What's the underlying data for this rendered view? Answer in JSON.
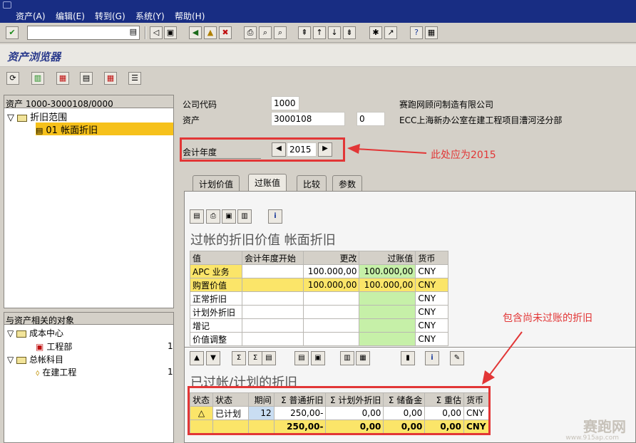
{
  "menu": [
    "资产(A)",
    "编辑(E)",
    "转到(G)",
    "系统(Y)",
    "帮助(H)"
  ],
  "title": "资产浏览器",
  "tree": {
    "header": "资产 1000-3000108/0000",
    "node": "折旧范围",
    "leaf": "01 帐面折旧"
  },
  "tree2": {
    "header": "与资产相关的对象",
    "cc": "成本中心",
    "cc_item": "工程部",
    "cc_count": "1",
    "gl": "总帐科目",
    "gl_item": "在建工程",
    "gl_count": "1"
  },
  "company": {
    "label": "公司代码",
    "value": "1000",
    "name": "赛跑网顾问制造有限公司"
  },
  "asset": {
    "label": "资产",
    "value": "3000108",
    "sub": "0",
    "name": "ECC上海新办公室在建工程项目漕河泾分部"
  },
  "fiscal": {
    "label": "会计年度",
    "value": "2015"
  },
  "annotation1": "此处应为2015",
  "annotation2": "包含尚未过账的折旧",
  "tabs": [
    "计划价值",
    "过账值",
    "比较",
    "参数"
  ],
  "section1_title": "过帐的折旧价值 帐面折旧",
  "table1": {
    "headers": [
      "值",
      "会计年度开始",
      "更改",
      "过账值",
      "货币"
    ],
    "rows": [
      [
        "APC 业务",
        "",
        "100.000,00",
        "100.000,00",
        "CNY"
      ],
      [
        "购置价值",
        "",
        "100.000,00",
        "100.000,00",
        "CNY"
      ],
      [
        "正常折旧",
        "",
        "",
        "",
        "CNY"
      ],
      [
        "计划外折旧",
        "",
        "",
        "",
        "CNY"
      ],
      [
        "增记",
        "",
        "",
        "",
        "CNY"
      ],
      [
        "价值调整",
        "",
        "",
        "",
        "CNY"
      ]
    ]
  },
  "section2_title": "已过帐/计划的折旧",
  "table2": {
    "headers": [
      "状态",
      "状态",
      "期间",
      "Σ 普通折旧",
      "Σ 计划外折旧",
      "Σ 储备金",
      "Σ 重估",
      "货币"
    ],
    "row": [
      "△",
      "已计划",
      "12",
      "250,00-",
      "0,00",
      "0,00",
      "0,00",
      "CNY"
    ],
    "sum": [
      "",
      "",
      "",
      "250,00-",
      "0,00",
      "0,00",
      "0,00",
      "CNY"
    ]
  },
  "watermark": "赛跑网",
  "watermark_url": "www.915ap.com"
}
